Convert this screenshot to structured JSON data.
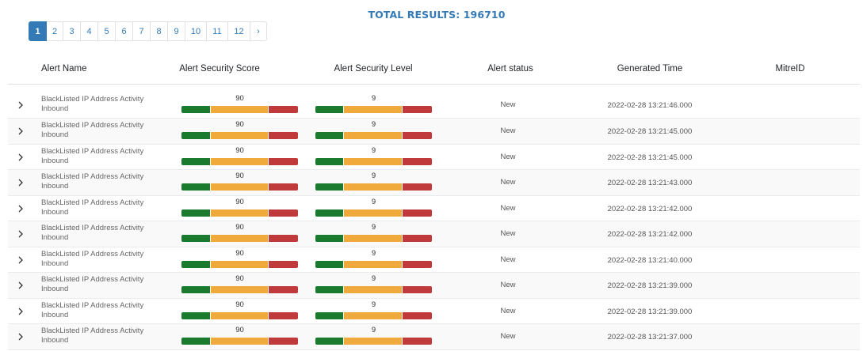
{
  "total_label": "TOTAL RESULTS: 196710",
  "pagination": {
    "pages": [
      "1",
      "2",
      "3",
      "4",
      "5",
      "6",
      "7",
      "8",
      "9",
      "10",
      "11",
      "12"
    ],
    "active": "1",
    "next": "›"
  },
  "columns": {
    "alert_name": "Alert Name",
    "score": "Alert Security Score",
    "level": "Alert Security Level",
    "status": "Alert status",
    "generated_time": "Generated Time",
    "mitre": "MitreID"
  },
  "colors": {
    "accent": "#337ab7",
    "bar_green": "#1a7a2e",
    "bar_orange": "#f0aa3c",
    "bar_red": "#c0393b"
  },
  "expand_icon": "chevron-right-icon",
  "rows": [
    {
      "name": "BlackListed IP Address Activity Inbound",
      "score": "90",
      "level": "9",
      "status": "New",
      "time": "2022-02-28 13:21:46.000",
      "mitre": ""
    },
    {
      "name": "BlackListed IP Address Activity Inbound",
      "score": "90",
      "level": "9",
      "status": "New",
      "time": "2022-02-28 13:21:45.000",
      "mitre": ""
    },
    {
      "name": "BlackListed IP Address Activity Inbound",
      "score": "90",
      "level": "9",
      "status": "New",
      "time": "2022-02-28 13:21:45.000",
      "mitre": ""
    },
    {
      "name": "BlackListed IP Address Activity Inbound",
      "score": "90",
      "level": "9",
      "status": "New",
      "time": "2022-02-28 13:21:43.000",
      "mitre": ""
    },
    {
      "name": "BlackListed IP Address Activity Inbound",
      "score": "90",
      "level": "9",
      "status": "New",
      "time": "2022-02-28 13:21:42.000",
      "mitre": ""
    },
    {
      "name": "BlackListed IP Address Activity Inbound",
      "score": "90",
      "level": "9",
      "status": "New",
      "time": "2022-02-28 13:21:42.000",
      "mitre": ""
    },
    {
      "name": "BlackListed IP Address Activity Inbound",
      "score": "90",
      "level": "9",
      "status": "New",
      "time": "2022-02-28 13:21:40.000",
      "mitre": ""
    },
    {
      "name": "BlackListed IP Address Activity Inbound",
      "score": "90",
      "level": "9",
      "status": "New",
      "time": "2022-02-28 13:21:39.000",
      "mitre": ""
    },
    {
      "name": "BlackListed IP Address Activity Inbound",
      "score": "90",
      "level": "9",
      "status": "New",
      "time": "2022-02-28 13:21:39.000",
      "mitre": ""
    },
    {
      "name": "BlackListed IP Address Activity Inbound",
      "score": "90",
      "level": "9",
      "status": "New",
      "time": "2022-02-28 13:21:37.000",
      "mitre": ""
    }
  ]
}
